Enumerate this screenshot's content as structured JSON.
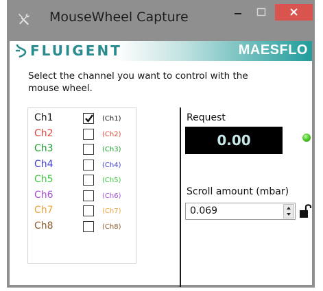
{
  "window": {
    "title": "MouseWheel Capture"
  },
  "banner": {
    "brand": "FLUIGENT",
    "product": "MAESFLO"
  },
  "instructions": "Select the channel you want to control with the mouse wheel.",
  "channels": [
    {
      "name": "Ch1",
      "tag": "(Ch1)",
      "checked": true,
      "color": "#111111"
    },
    {
      "name": "Ch2",
      "tag": "(Ch2)",
      "checked": false,
      "color": "#e0453a"
    },
    {
      "name": "Ch3",
      "tag": "(Ch3)",
      "checked": false,
      "color": "#1d9b2b"
    },
    {
      "name": "Ch4",
      "tag": "(Ch4)",
      "checked": false,
      "color": "#3f3fd0"
    },
    {
      "name": "Ch5",
      "tag": "(Ch5)",
      "checked": false,
      "color": "#3fc43f"
    },
    {
      "name": "Ch6",
      "tag": "(Ch6)",
      "checked": false,
      "color": "#a64fd3"
    },
    {
      "name": "Ch7",
      "tag": "(Ch7)",
      "checked": false,
      "color": "#e8a33a"
    },
    {
      "name": "Ch8",
      "tag": "(Ch8)",
      "checked": false,
      "color": "#8a5a2b"
    }
  ],
  "request": {
    "label": "Request",
    "value": "0.00",
    "status_color": "#40c21d"
  },
  "scroll": {
    "label": "Scroll amount (mbar)",
    "value": "0.069"
  },
  "colors": {
    "titlebar": "#8f8f8f",
    "close": "#d9534f",
    "brand": "#2a8b8e",
    "banner_end": "#219c9c"
  }
}
